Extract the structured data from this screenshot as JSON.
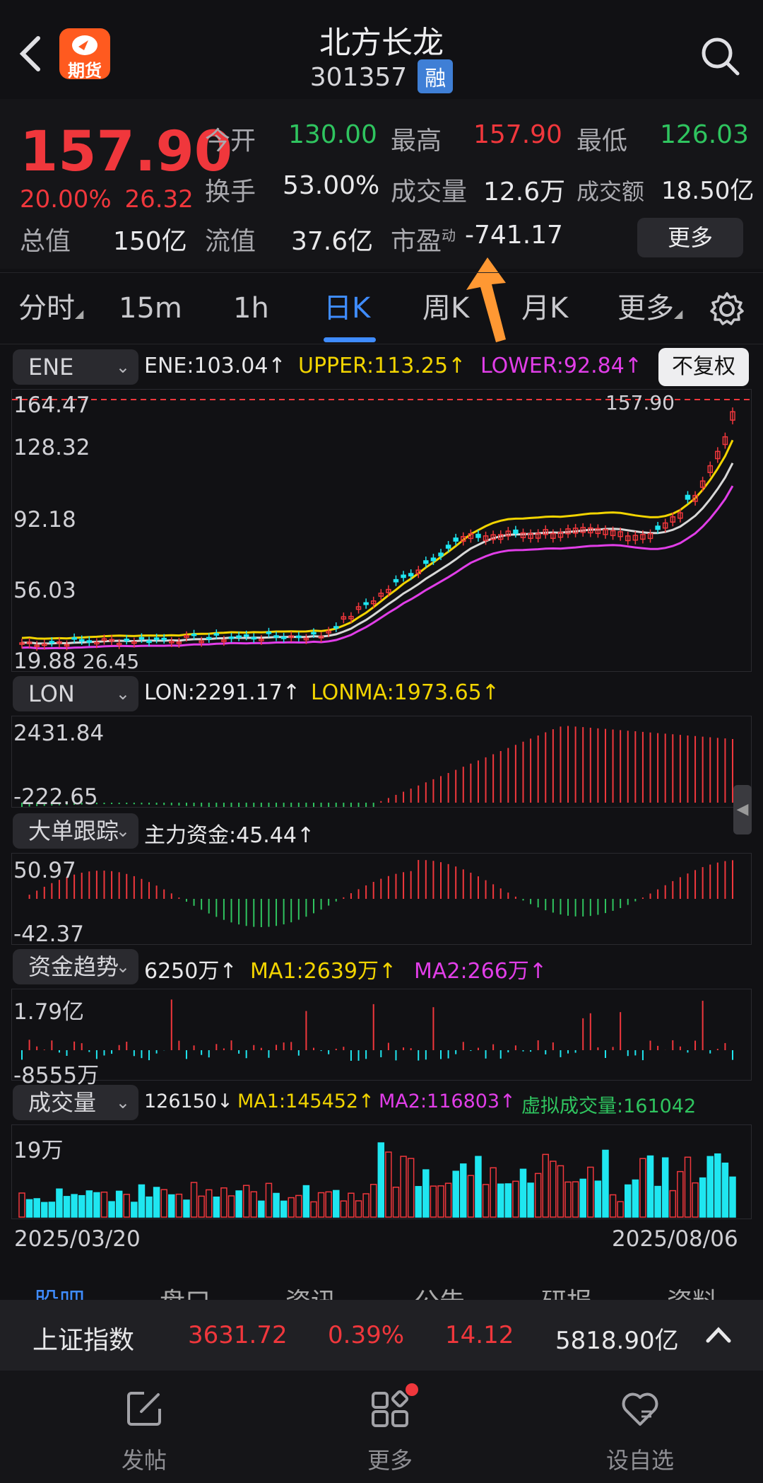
{
  "header": {
    "title": "北方长龙",
    "code": "301357",
    "margin_badge": "融",
    "futures_badge": "期货"
  },
  "quote": {
    "price": "157.90",
    "change_pct": "20.00%",
    "change_abs": "26.32",
    "rows": [
      [
        {
          "label": "今开",
          "value": "130.00",
          "tone": "green"
        },
        {
          "label": "最高",
          "value": "157.90",
          "tone": "red"
        },
        {
          "label": "最低",
          "value": "126.03",
          "tone": "green"
        }
      ],
      [
        {
          "label": "换手",
          "value": "53.00%",
          "tone": "white"
        },
        {
          "label": "成交量",
          "value": "12.6万",
          "tone": "white"
        },
        {
          "label": "成交额",
          "value": "18.50亿",
          "tone": "white"
        }
      ]
    ],
    "market_cap_label": "总值",
    "market_cap": "150亿",
    "float_cap_label": "流值",
    "float_cap": "37.6亿",
    "pe_label": "市盈",
    "pe_sup": "动",
    "pe_value": "-741.17",
    "more_label": "更多"
  },
  "tabs": [
    {
      "label": "分时",
      "active": false
    },
    {
      "label": "15m",
      "active": false
    },
    {
      "label": "1h",
      "active": false
    },
    {
      "label": "日K",
      "active": true
    },
    {
      "label": "周K",
      "active": false
    },
    {
      "label": "月K",
      "active": false
    },
    {
      "label": "更多",
      "active": false
    }
  ],
  "ene": {
    "selector": "ENE",
    "ene": "ENE:103.04↑",
    "upper": "UPPER:113.25↑",
    "lower": "LOWER:92.84↑",
    "fq_label": "不复权",
    "y_labels": [
      "164.47",
      "128.32",
      "92.18",
      "56.03",
      "19.88"
    ],
    "low_mark": "26.45",
    "high_mark": "157.90"
  },
  "lon": {
    "selector": "LON",
    "lon": "LON:2291.17↑",
    "lonma": "LONMA:1973.65↑",
    "y_labels": [
      "2431.84",
      "-222.65"
    ]
  },
  "bigorder": {
    "selector": "大单跟踪",
    "main": "主力资金:45.44↑",
    "y_labels": [
      "50.97",
      "-42.37"
    ]
  },
  "fund": {
    "selector": "资金趋势",
    "value": "6250万↑",
    "ma1": "MA1:2639万↑",
    "ma2": "MA2:266万↑",
    "y_labels": [
      "1.79亿",
      "-8555万"
    ]
  },
  "volume": {
    "selector": "成交量",
    "value": "126150↓",
    "ma1": "MA1:145452↑",
    "ma2": "MA2:116803↑",
    "virtual": "虚拟成交量:161042",
    "y_label": "19万"
  },
  "dates": {
    "start": "2025/03/20",
    "end": "2025/08/06"
  },
  "hidden_tabs": [
    "股吧",
    "盘口",
    "资讯",
    "公告",
    "研报",
    "资料"
  ],
  "index_bar": {
    "name": "上证指数",
    "value": "3631.72",
    "pct": "0.39%",
    "change": "14.12",
    "turnover": "5818.90亿"
  },
  "nav": [
    {
      "label": "发帖",
      "icon": "edit-icon"
    },
    {
      "label": "更多",
      "icon": "grid-icon"
    },
    {
      "label": "设自选",
      "icon": "heart-icon"
    }
  ],
  "colors": {
    "up": "#f0373c",
    "down": "#2fc45f",
    "accent": "#3f8cff",
    "cyan": "#1fe6f0"
  }
}
